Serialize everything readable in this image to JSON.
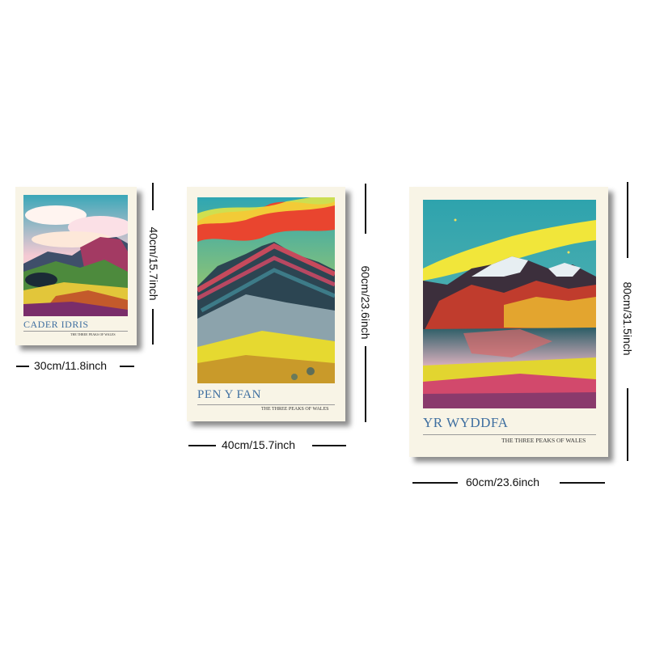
{
  "posters": [
    {
      "title": "CADER IDRIS",
      "subtitle": "THE THREE PEAKS OF WALES",
      "width_label": "30cm/11.8inch",
      "height_label": "40cm/15.7inch"
    },
    {
      "title": "PEN Y FAN",
      "subtitle": "THE THREE PEAKS OF WALES",
      "width_label": "40cm/15.7inch",
      "height_label": "60cm/23.6inch"
    },
    {
      "title": "YR WYDDFA",
      "subtitle": "THE THREE PEAKS OF WALES",
      "width_label": "60cm/23.6inch",
      "height_label": "80cm/31.5inch"
    }
  ],
  "colors": {
    "title": "#3f6fa0",
    "paper": "#f8f4e6",
    "dimension": "#111111"
  }
}
